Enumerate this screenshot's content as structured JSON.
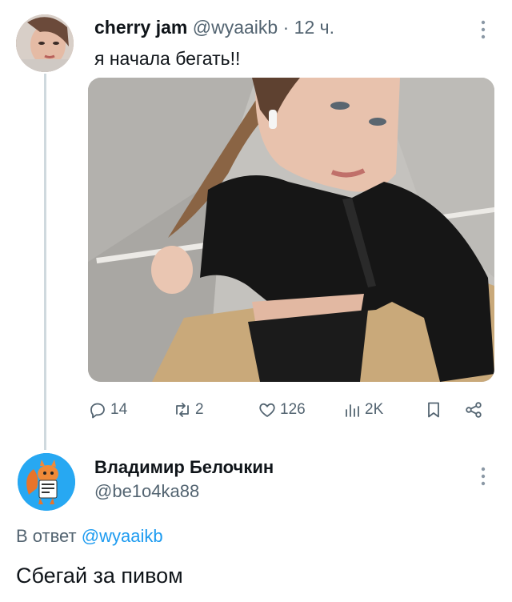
{
  "tweet": {
    "author_name": "cherry jam",
    "author_handle": "@wyaaikb",
    "separator": "·",
    "time": "12 ч.",
    "text": "я начала бегать!!",
    "stats": {
      "replies": "14",
      "retweets": "2",
      "likes": "126",
      "views": "2K"
    },
    "icons": {
      "reply": "reply-icon",
      "retweet": "retweet-icon",
      "like": "heart-icon",
      "views": "views-chart-icon",
      "bookmark": "bookmark-icon",
      "share": "share-icon",
      "more": "more-vertical-icon"
    }
  },
  "reply": {
    "author_name": "Владимир Белочкин",
    "author_handle": "@be1o4ka88",
    "reply_prefix": "В ответ",
    "reply_mention": "@wyaaikb",
    "text": "Сбегай за пивом"
  },
  "colors": {
    "secondary_text": "#536471",
    "link": "#1d9bf0",
    "thread_line": "#cfd9de"
  }
}
